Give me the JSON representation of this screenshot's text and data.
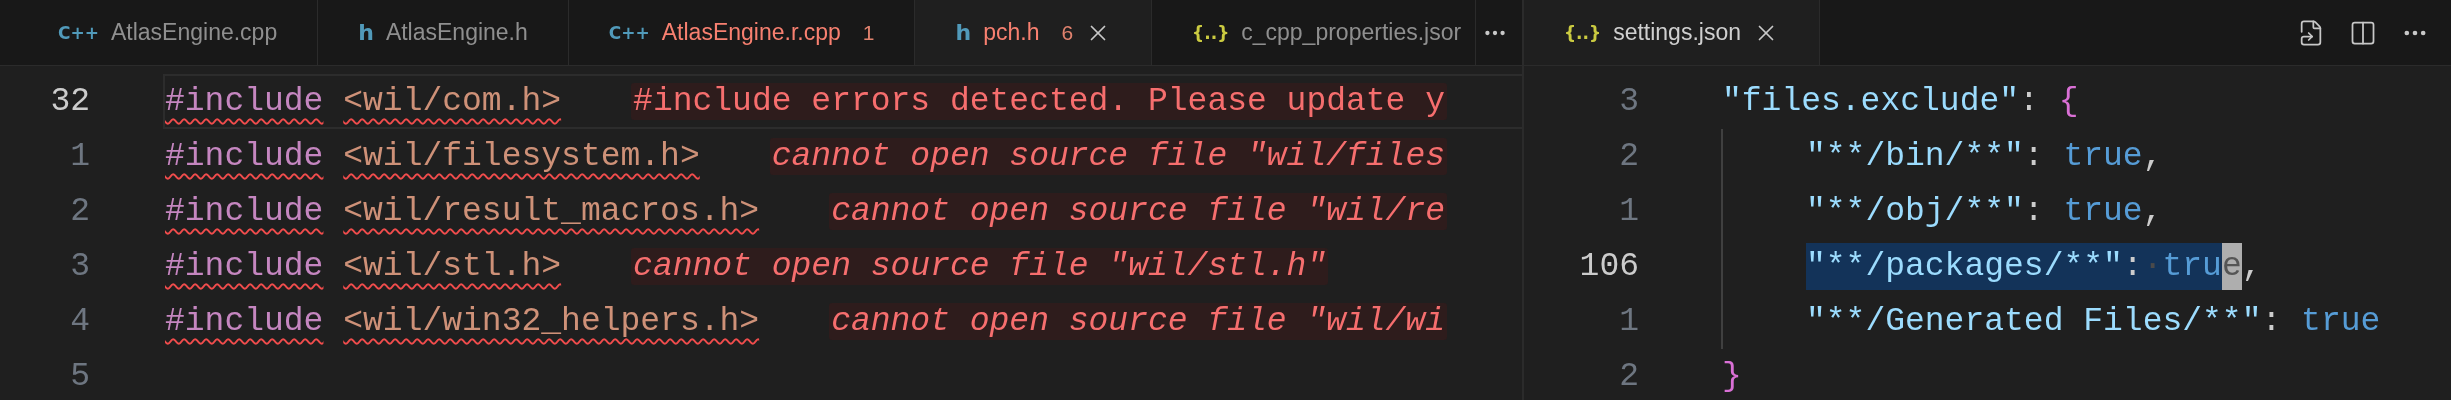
{
  "left_group": {
    "tabs": [
      {
        "kind": "cpp",
        "icon": "C++",
        "label": "AtlasEngine.cpp",
        "has_errors": false,
        "selected": false
      },
      {
        "kind": "header",
        "icon": "h",
        "label": "AtlasEngine.h",
        "has_errors": false,
        "selected": false
      },
      {
        "kind": "cpp",
        "icon": "C++",
        "label": "AtlasEngine.r.cpp",
        "problems": "1",
        "has_errors": true,
        "selected": false
      },
      {
        "kind": "header",
        "icon": "h",
        "label": "pch.h",
        "problems": "6",
        "has_errors": true,
        "selected": true
      },
      {
        "kind": "json",
        "icon": "{..}",
        "label": "c_cpp_properties.jsor",
        "has_errors": false,
        "selected": false
      }
    ],
    "lines": [
      {
        "number": "32",
        "current": true,
        "directive": "#include",
        "path": "<wil/com.h>",
        "diagnostic": "#include errors detected. Please update y",
        "italic": false
      },
      {
        "number": "1",
        "current": false,
        "directive": "#include",
        "path": "<wil/filesystem.h>",
        "diagnostic": "cannot open source file \"wil/files",
        "italic": true
      },
      {
        "number": "2",
        "current": false,
        "directive": "#include",
        "path": "<wil/result_macros.h>",
        "diagnostic": "cannot open source file \"wil/re",
        "italic": true
      },
      {
        "number": "3",
        "current": false,
        "directive": "#include",
        "path": "<wil/stl.h>",
        "diagnostic": "cannot open source file \"wil/stl.h\"",
        "italic": true
      },
      {
        "number": "4",
        "current": false,
        "directive": "#include",
        "path": "<wil/win32_helpers.h>",
        "diagnostic": "cannot open source file \"wil/wi",
        "italic": true
      },
      {
        "number": "5",
        "current": false
      }
    ]
  },
  "right_group": {
    "tabs": [
      {
        "kind": "json",
        "icon": "{..}",
        "label": "settings.json",
        "has_errors": false,
        "selected": true
      }
    ],
    "lines": [
      {
        "number": "3",
        "current": false,
        "tokens": [
          {
            "kind": "string",
            "text": "\"files.exclude\"",
            "selected": false
          },
          {
            "kind": "punct",
            "text": ": ",
            "selected": false
          },
          {
            "kind": "brace",
            "text": "{",
            "selected": false
          }
        ],
        "children": [
          {
            "number": "2",
            "current": false,
            "tokens": [
              {
                "kind": "string",
                "text": "\"**/bin/**\"",
                "selected": false
              },
              {
                "kind": "punct",
                "text": ": ",
                "selected": false
              },
              {
                "kind": "bool",
                "text": "true",
                "selected": false
              },
              {
                "kind": "punct",
                "text": ",",
                "selected": false
              }
            ]
          },
          {
            "number": "1",
            "current": false,
            "tokens": [
              {
                "kind": "string",
                "text": "\"**/obj/**\"",
                "selected": false
              },
              {
                "kind": "punct",
                "text": ": ",
                "selected": false
              },
              {
                "kind": "bool",
                "text": "true",
                "selected": false
              },
              {
                "kind": "punct",
                "text": ",",
                "selected": false
              }
            ]
          },
          {
            "number": "106",
            "current": true,
            "tokens": [
              {
                "kind": "string",
                "text": "\"**/packages/**\"",
                "selected": true
              },
              {
                "kind": "punct",
                "text": ":",
                "selected": true
              },
              {
                "kind": "whitespace",
                "text": "·",
                "selected": true
              },
              {
                "kind": "bool",
                "text": "tru",
                "selected": true
              },
              {
                "kind": "cursor",
                "text": "e",
                "selected": false
              },
              {
                "kind": "punct",
                "text": ",",
                "selected": false
              }
            ]
          },
          {
            "number": "1",
            "current": false,
            "tokens": [
              {
                "kind": "string",
                "text": "\"**/Generated Files/**\"",
                "selected": false
              },
              {
                "kind": "punct",
                "text": ": ",
                "selected": false
              },
              {
                "kind": "bool",
                "text": "true",
                "selected": false
              }
            ]
          }
        ]
      },
      {
        "number": "2",
        "current": false,
        "tokens": [
          {
            "kind": "brace",
            "text": "}",
            "selected": false
          }
        ]
      }
    ]
  }
}
